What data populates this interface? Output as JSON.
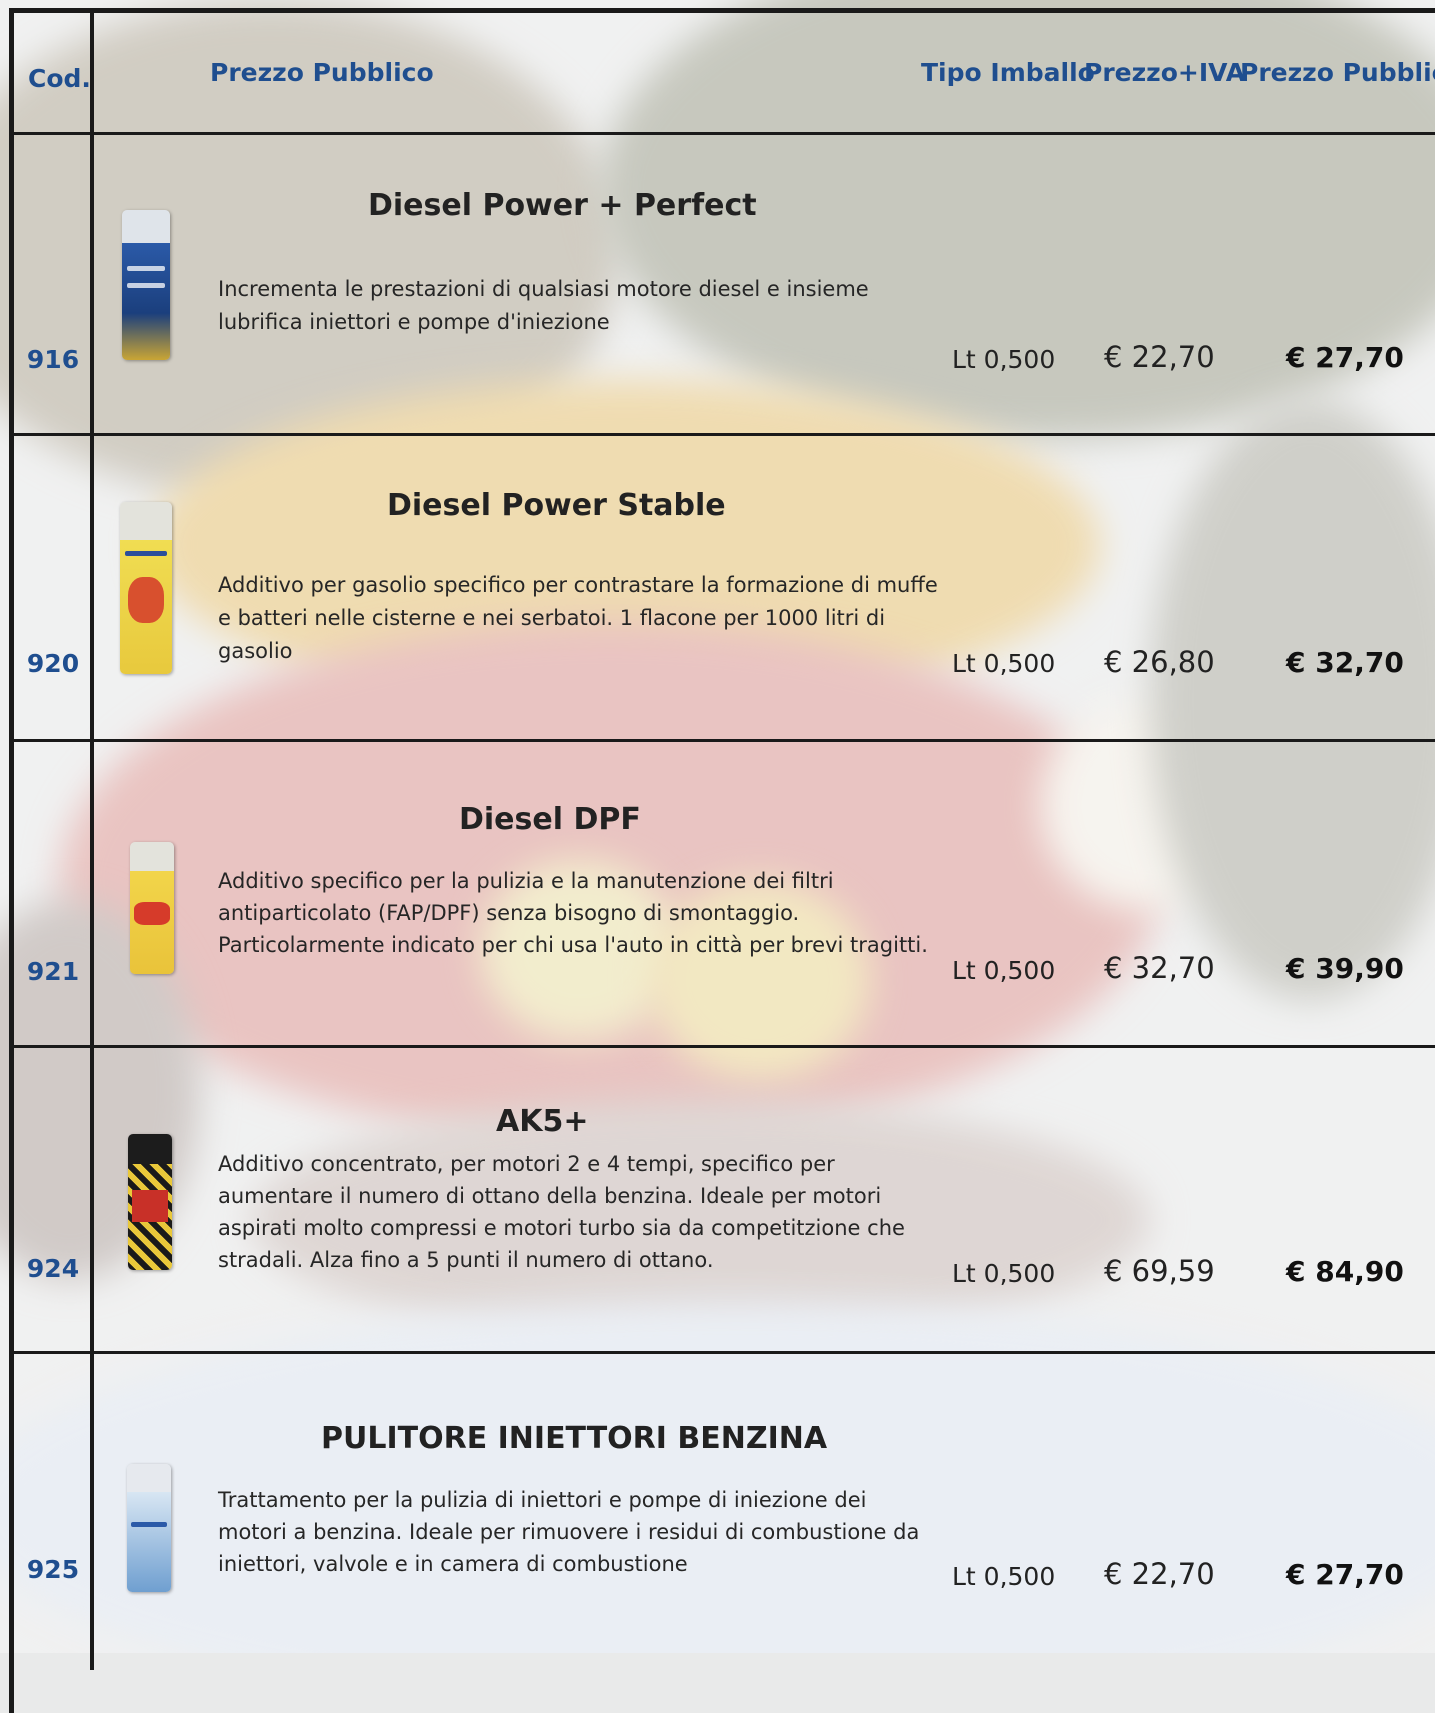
{
  "header": {
    "cod": "Cod.",
    "description_col": "Prezzo Pubblico",
    "pack_type": "Tipo Imballo",
    "price_vat": "Prezzo+IVA",
    "public_price": "Prezzo Pubblico"
  },
  "colors": {
    "header_blue": "#1f4e8f",
    "border": "#1a1a1a"
  },
  "products": [
    {
      "code": "916",
      "name": "Diesel Power + Perfect",
      "description": "Incrementa le prestazioni di qualsiasi motore diesel e insieme lubrifica iniettori e pompe d'iniezione",
      "pack": "Lt 0,500",
      "price_vat": "€ 22,70",
      "public_price": "€ 27,70",
      "icon": "blue-spray-can-icon"
    },
    {
      "code": "920",
      "name": "Diesel Power Stable",
      "description": "Additivo per gasolio specifico per contrastare la formazione di muffe e batteri nelle cisterne e nei serbatoi. 1 flacone per 1000 litri di gasolio",
      "pack": "Lt 0,500",
      "price_vat": "€ 26,80",
      "public_price": "€ 32,70",
      "icon": "yellow-spray-can-icon"
    },
    {
      "code": "921",
      "name": "Diesel DPF",
      "description": "Additivo specifico per la pulizia e la manutenzione dei filtri antiparticolato (FAP/DPF) senza bisogno di smontaggio. Particolarmente indicato per chi usa l'auto in città per brevi tragitti.",
      "pack": "Lt 0,500",
      "price_vat": "€ 32,70",
      "public_price": "€ 39,90",
      "icon": "yellow-red-spray-can-icon"
    },
    {
      "code": "924",
      "name": "AK5+",
      "description": "Additivo concentrato, per motori 2 e 4 tempi, specifico per aumentare il numero di ottano della benzina. Ideale per motori aspirati molto compressi e motori turbo sia da competitzione che stradali. Alza fino a 5 punti il numero di ottano.",
      "pack": "Lt 0,500",
      "price_vat": "€ 69,59",
      "public_price": "€ 84,90",
      "icon": "black-checkered-can-icon"
    },
    {
      "code": "925",
      "name": "PULITORE INIETTORI BENZINA",
      "description": "Trattamento per la pulizia di iniettori e pompe di iniezione dei motori a benzina. Ideale per rimuovere i residui di combustione da iniettori, valvole e in camera di combustione",
      "pack": "Lt 0,500",
      "price_vat": "€ 22,70",
      "public_price": "€ 27,70",
      "icon": "light-blue-spray-can-icon"
    }
  ]
}
